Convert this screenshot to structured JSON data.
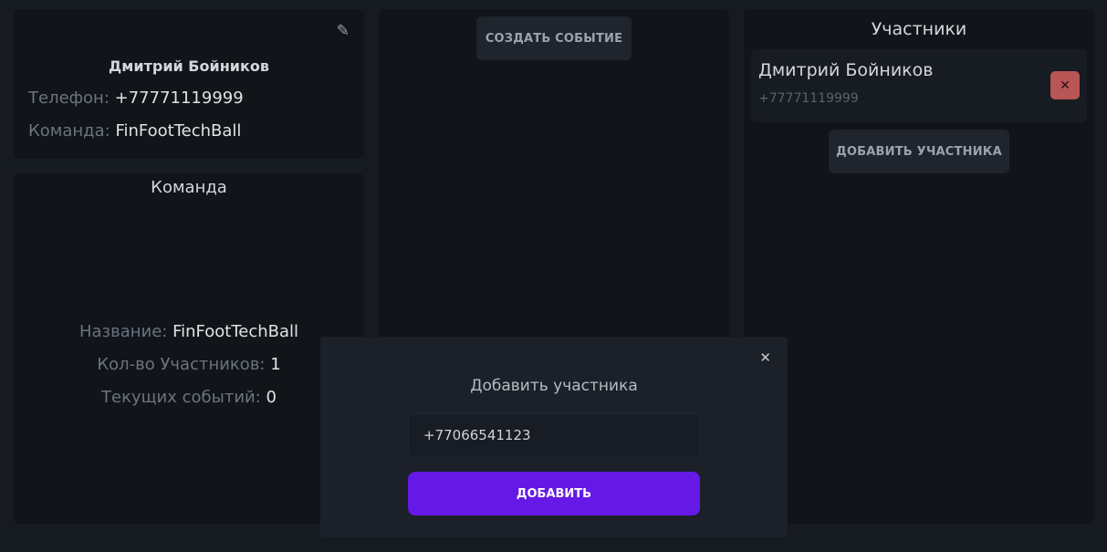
{
  "profile": {
    "edit_icon": "✎",
    "name": "Дмитрий Бойников",
    "phone_label": "Телефон:",
    "phone_value": "+77771119999",
    "team_label": "Команда:",
    "team_value": "FinFootTechBall"
  },
  "team": {
    "title": "Команда",
    "name_label": "Название:",
    "name_value": "FinFootTechBall",
    "members_label": "Кол-во Участников:",
    "members_value": "1",
    "events_label": "Текущих событий:",
    "events_value": "0"
  },
  "events": {
    "create_button": "СОЗДАТЬ СОБЫТИЕ"
  },
  "participants": {
    "title": "Участники",
    "items": [
      {
        "name": "Дмитрий Бойников",
        "phone": "+77771119999",
        "remove_icon": "✕"
      }
    ],
    "add_button": "ДОБАВИТЬ УЧАСТНИКА"
  },
  "modal": {
    "close_icon": "✕",
    "title": "Добавить участника",
    "input_value": "+77066541123",
    "submit_button": "ДОБАВИТЬ"
  },
  "colors": {
    "accent": "#6419e6",
    "danger": "#b85555",
    "background": "#161a21",
    "panel": "#111419"
  }
}
